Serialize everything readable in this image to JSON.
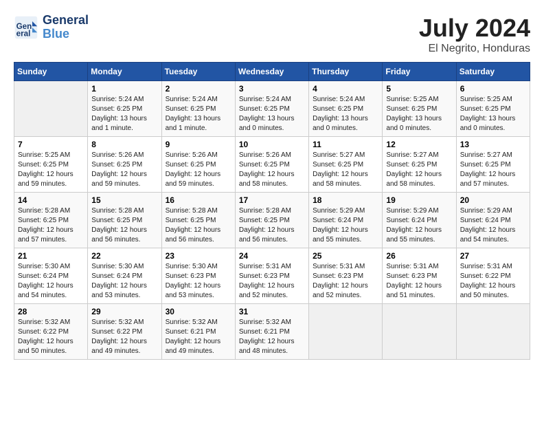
{
  "header": {
    "logo_line1": "General",
    "logo_line2": "Blue",
    "title": "July 2024",
    "subtitle": "El Negrito, Honduras"
  },
  "weekdays": [
    "Sunday",
    "Monday",
    "Tuesday",
    "Wednesday",
    "Thursday",
    "Friday",
    "Saturday"
  ],
  "weeks": [
    [
      {
        "day": "",
        "info": ""
      },
      {
        "day": "1",
        "info": "Sunrise: 5:24 AM\nSunset: 6:25 PM\nDaylight: 13 hours\nand 1 minute."
      },
      {
        "day": "2",
        "info": "Sunrise: 5:24 AM\nSunset: 6:25 PM\nDaylight: 13 hours\nand 1 minute."
      },
      {
        "day": "3",
        "info": "Sunrise: 5:24 AM\nSunset: 6:25 PM\nDaylight: 13 hours\nand 0 minutes."
      },
      {
        "day": "4",
        "info": "Sunrise: 5:24 AM\nSunset: 6:25 PM\nDaylight: 13 hours\nand 0 minutes."
      },
      {
        "day": "5",
        "info": "Sunrise: 5:25 AM\nSunset: 6:25 PM\nDaylight: 13 hours\nand 0 minutes."
      },
      {
        "day": "6",
        "info": "Sunrise: 5:25 AM\nSunset: 6:25 PM\nDaylight: 13 hours\nand 0 minutes."
      }
    ],
    [
      {
        "day": "7",
        "info": "Sunrise: 5:25 AM\nSunset: 6:25 PM\nDaylight: 12 hours\nand 59 minutes."
      },
      {
        "day": "8",
        "info": "Sunrise: 5:26 AM\nSunset: 6:25 PM\nDaylight: 12 hours\nand 59 minutes."
      },
      {
        "day": "9",
        "info": "Sunrise: 5:26 AM\nSunset: 6:25 PM\nDaylight: 12 hours\nand 59 minutes."
      },
      {
        "day": "10",
        "info": "Sunrise: 5:26 AM\nSunset: 6:25 PM\nDaylight: 12 hours\nand 58 minutes."
      },
      {
        "day": "11",
        "info": "Sunrise: 5:27 AM\nSunset: 6:25 PM\nDaylight: 12 hours\nand 58 minutes."
      },
      {
        "day": "12",
        "info": "Sunrise: 5:27 AM\nSunset: 6:25 PM\nDaylight: 12 hours\nand 58 minutes."
      },
      {
        "day": "13",
        "info": "Sunrise: 5:27 AM\nSunset: 6:25 PM\nDaylight: 12 hours\nand 57 minutes."
      }
    ],
    [
      {
        "day": "14",
        "info": "Sunrise: 5:28 AM\nSunset: 6:25 PM\nDaylight: 12 hours\nand 57 minutes."
      },
      {
        "day": "15",
        "info": "Sunrise: 5:28 AM\nSunset: 6:25 PM\nDaylight: 12 hours\nand 56 minutes."
      },
      {
        "day": "16",
        "info": "Sunrise: 5:28 AM\nSunset: 6:25 PM\nDaylight: 12 hours\nand 56 minutes."
      },
      {
        "day": "17",
        "info": "Sunrise: 5:28 AM\nSunset: 6:25 PM\nDaylight: 12 hours\nand 56 minutes."
      },
      {
        "day": "18",
        "info": "Sunrise: 5:29 AM\nSunset: 6:24 PM\nDaylight: 12 hours\nand 55 minutes."
      },
      {
        "day": "19",
        "info": "Sunrise: 5:29 AM\nSunset: 6:24 PM\nDaylight: 12 hours\nand 55 minutes."
      },
      {
        "day": "20",
        "info": "Sunrise: 5:29 AM\nSunset: 6:24 PM\nDaylight: 12 hours\nand 54 minutes."
      }
    ],
    [
      {
        "day": "21",
        "info": "Sunrise: 5:30 AM\nSunset: 6:24 PM\nDaylight: 12 hours\nand 54 minutes."
      },
      {
        "day": "22",
        "info": "Sunrise: 5:30 AM\nSunset: 6:24 PM\nDaylight: 12 hours\nand 53 minutes."
      },
      {
        "day": "23",
        "info": "Sunrise: 5:30 AM\nSunset: 6:23 PM\nDaylight: 12 hours\nand 53 minutes."
      },
      {
        "day": "24",
        "info": "Sunrise: 5:31 AM\nSunset: 6:23 PM\nDaylight: 12 hours\nand 52 minutes."
      },
      {
        "day": "25",
        "info": "Sunrise: 5:31 AM\nSunset: 6:23 PM\nDaylight: 12 hours\nand 52 minutes."
      },
      {
        "day": "26",
        "info": "Sunrise: 5:31 AM\nSunset: 6:23 PM\nDaylight: 12 hours\nand 51 minutes."
      },
      {
        "day": "27",
        "info": "Sunrise: 5:31 AM\nSunset: 6:22 PM\nDaylight: 12 hours\nand 50 minutes."
      }
    ],
    [
      {
        "day": "28",
        "info": "Sunrise: 5:32 AM\nSunset: 6:22 PM\nDaylight: 12 hours\nand 50 minutes."
      },
      {
        "day": "29",
        "info": "Sunrise: 5:32 AM\nSunset: 6:22 PM\nDaylight: 12 hours\nand 49 minutes."
      },
      {
        "day": "30",
        "info": "Sunrise: 5:32 AM\nSunset: 6:21 PM\nDaylight: 12 hours\nand 49 minutes."
      },
      {
        "day": "31",
        "info": "Sunrise: 5:32 AM\nSunset: 6:21 PM\nDaylight: 12 hours\nand 48 minutes."
      },
      {
        "day": "",
        "info": ""
      },
      {
        "day": "",
        "info": ""
      },
      {
        "day": "",
        "info": ""
      }
    ]
  ]
}
